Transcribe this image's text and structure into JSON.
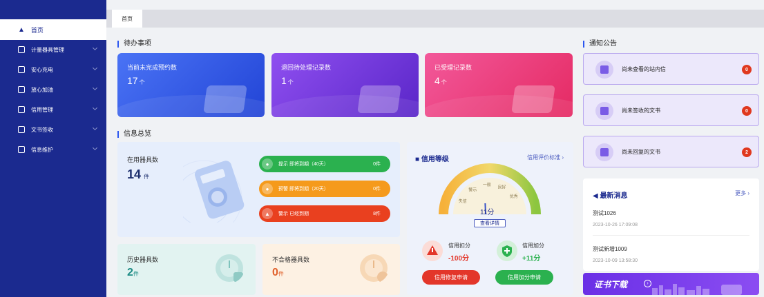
{
  "tabs": [
    {
      "label": "首页"
    }
  ],
  "sidebar": {
    "home": "首页",
    "items": [
      {
        "label": "计量器具管理",
        "icon": "monitor-icon"
      },
      {
        "label": "安心充电",
        "icon": "charger-icon"
      },
      {
        "label": "放心加油",
        "icon": "fuel-icon"
      },
      {
        "label": "信用管理",
        "icon": "shield-icon"
      },
      {
        "label": "文书签收",
        "icon": "document-icon"
      },
      {
        "label": "信息维护",
        "icon": "edit-icon"
      }
    ]
  },
  "sections": {
    "todo": "待办事项",
    "overview": "信息总览",
    "notice": "通知公告"
  },
  "todo_cards": [
    {
      "label": "当前未完成预约数",
      "value": "17",
      "unit": "个"
    },
    {
      "label": "退回待处理记录数",
      "value": "1",
      "unit": "个"
    },
    {
      "label": "已受理记录数",
      "value": "4",
      "unit": "个"
    }
  ],
  "in_use": {
    "label": "在用器具数",
    "value": "14",
    "unit": "件"
  },
  "expiry_pills": [
    {
      "label": "提示 即将到期（40天）",
      "count": "0件",
      "color": "#2bb14f"
    },
    {
      "label": "预警 即将到期（20天）",
      "count": "0件",
      "color": "#f59a1c"
    },
    {
      "label": "警示 已经到期",
      "count": "8件",
      "color": "#e9401f"
    }
  ],
  "history": {
    "label": "历史器具数",
    "value": "2",
    "unit": "件"
  },
  "nonconforming": {
    "label": "不合格器具数",
    "value": "0",
    "unit": "件"
  },
  "credit": {
    "title": "信用等级",
    "link": "信用评价标准",
    "gauge_labels": [
      "失信",
      "警示",
      "一般",
      "良好",
      "优秀"
    ],
    "score": "11分",
    "score_value": 11,
    "detail": "查看详情",
    "deduct_label": "信用扣分",
    "deduct_value": "-100分",
    "add_label": "信用加分",
    "add_value": "+11分",
    "repair_button": "信用修复申请",
    "add_button": "信用加分申请"
  },
  "notices": [
    {
      "label": "尚未查看的站内信",
      "count": "0"
    },
    {
      "label": "尚未签收的文书",
      "count": "0"
    },
    {
      "label": "尚未回复的文书",
      "count": "2"
    }
  ],
  "news": {
    "title": "最新消息",
    "more": "更多",
    "items": [
      {
        "title": "测试1026",
        "date": "2023-10-26 17:09:08"
      },
      {
        "title": "测试新增1009",
        "date": "2023-10-09 13:58:30"
      }
    ]
  },
  "download": {
    "label": "证书下载"
  },
  "colors": {
    "sidebar": "#1b2a8f",
    "accent": "#2b56f0"
  }
}
